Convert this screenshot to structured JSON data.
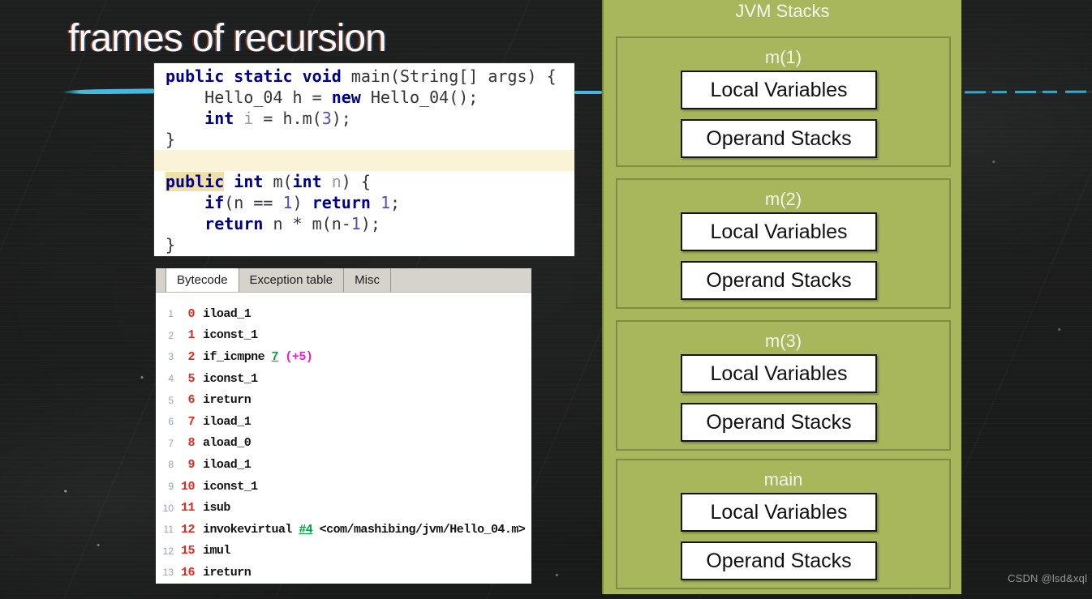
{
  "slide": {
    "title": "frames of recursion",
    "watermark": "CSDN @lsd&xql"
  },
  "colors": {
    "chalk_accent_line": "#44b8e0",
    "panel_green": "#a8b65c",
    "frame_border": "#7e8c45",
    "keyword_navy": "#000083",
    "number_blue": "#4e4ec8",
    "current_line_highlight": "#fbf3d8",
    "token_highlight": "#eee0a7",
    "offset_red": "#e22a1f",
    "jump_target_green": "#00a43c",
    "branch_magenta": "#f41ad1"
  },
  "code_editor": {
    "lines": [
      {
        "segs": [
          {
            "c": "kw",
            "t": "public static void"
          },
          {
            "c": "pl",
            "t": " main(String[] args) {"
          }
        ]
      },
      {
        "segs": [
          {
            "c": "pl",
            "t": "    Hello_04 h = "
          },
          {
            "c": "kw",
            "t": "new"
          },
          {
            "c": "pl",
            "t": " Hello_04();"
          }
        ]
      },
      {
        "segs": [
          {
            "c": "pl",
            "t": "    "
          },
          {
            "c": "kw",
            "t": "int"
          },
          {
            "c": "pl",
            "t": " "
          },
          {
            "c": "var",
            "t": "i"
          },
          {
            "c": "pl",
            "t": " = h.m("
          },
          {
            "c": "num",
            "t": "3"
          },
          {
            "c": "pl",
            "t": ");"
          }
        ]
      },
      {
        "segs": [
          {
            "c": "pl",
            "t": "}"
          }
        ]
      },
      {
        "hl": true,
        "segs": []
      },
      {
        "segs": [
          {
            "c": "kw hl",
            "t": "public"
          },
          {
            "c": "pl",
            "t": " "
          },
          {
            "c": "kw",
            "t": "int"
          },
          {
            "c": "pl",
            "t": " m("
          },
          {
            "c": "kw",
            "t": "int"
          },
          {
            "c": "pl",
            "t": " "
          },
          {
            "c": "var",
            "t": "n"
          },
          {
            "c": "pl",
            "t": ") {"
          }
        ]
      },
      {
        "segs": [
          {
            "c": "pl",
            "t": "    "
          },
          {
            "c": "kw",
            "t": "if"
          },
          {
            "c": "pl",
            "t": "(n == "
          },
          {
            "c": "num",
            "t": "1"
          },
          {
            "c": "pl",
            "t": ") "
          },
          {
            "c": "kw",
            "t": "return"
          },
          {
            "c": "pl",
            "t": " "
          },
          {
            "c": "num",
            "t": "1"
          },
          {
            "c": "pl",
            "t": ";"
          }
        ]
      },
      {
        "segs": [
          {
            "c": "pl",
            "t": "    "
          },
          {
            "c": "kw",
            "t": "return"
          },
          {
            "c": "pl",
            "t": " n * m(n-"
          },
          {
            "c": "num",
            "t": "1"
          },
          {
            "c": "pl",
            "t": ");"
          }
        ]
      },
      {
        "segs": [
          {
            "c": "pl",
            "t": "}"
          }
        ]
      }
    ]
  },
  "bytecode_panel": {
    "tabs": [
      "Bytecode",
      "Exception table",
      "Misc"
    ],
    "active_tab": "Bytecode",
    "rows": [
      {
        "line": "1",
        "offset": "0",
        "segs": [
          {
            "c": "i",
            "t": "iload_1"
          }
        ]
      },
      {
        "line": "2",
        "offset": "1",
        "segs": [
          {
            "c": "i",
            "t": "iconst_1"
          }
        ]
      },
      {
        "line": "3",
        "offset": "2",
        "segs": [
          {
            "c": "i",
            "t": "if_icmpne "
          },
          {
            "c": "g",
            "t": "7"
          },
          {
            "c": "m",
            "t": " (+5)"
          }
        ]
      },
      {
        "line": "4",
        "offset": "5",
        "segs": [
          {
            "c": "i",
            "t": "iconst_1"
          }
        ]
      },
      {
        "line": "5",
        "offset": "6",
        "segs": [
          {
            "c": "i",
            "t": "ireturn"
          }
        ]
      },
      {
        "line": "6",
        "offset": "7",
        "segs": [
          {
            "c": "i",
            "t": "iload_1"
          }
        ]
      },
      {
        "line": "7",
        "offset": "8",
        "segs": [
          {
            "c": "i",
            "t": "aload_0"
          }
        ]
      },
      {
        "line": "8",
        "offset": "9",
        "segs": [
          {
            "c": "i",
            "t": "iload_1"
          }
        ]
      },
      {
        "line": "9",
        "offset": "10",
        "segs": [
          {
            "c": "i",
            "t": "iconst_1"
          }
        ]
      },
      {
        "line": "10",
        "offset": "11",
        "segs": [
          {
            "c": "i",
            "t": "isub"
          }
        ]
      },
      {
        "line": "11",
        "offset": "12",
        "segs": [
          {
            "c": "i",
            "t": "invokevirtual "
          },
          {
            "c": "g",
            "t": "#4"
          },
          {
            "c": "i",
            "t": " <com/mashibing/jvm/Hello_04.m>"
          }
        ]
      },
      {
        "line": "12",
        "offset": "15",
        "segs": [
          {
            "c": "i",
            "t": "imul"
          }
        ]
      },
      {
        "line": "13",
        "offset": "16",
        "segs": [
          {
            "c": "i",
            "t": "ireturn"
          }
        ]
      }
    ]
  },
  "jvm_stacks": {
    "title": "JVM Stacks",
    "frames": [
      {
        "label": "m(1)",
        "boxes": [
          "Local Variables",
          "Operand Stacks"
        ]
      },
      {
        "label": "m(2)",
        "boxes": [
          "Local Variables",
          "Operand Stacks"
        ]
      },
      {
        "label": "m(3)",
        "boxes": [
          "Local Variables",
          "Operand Stacks"
        ]
      },
      {
        "label": "main",
        "boxes": [
          "Local Variables",
          "Operand Stacks"
        ]
      }
    ]
  }
}
